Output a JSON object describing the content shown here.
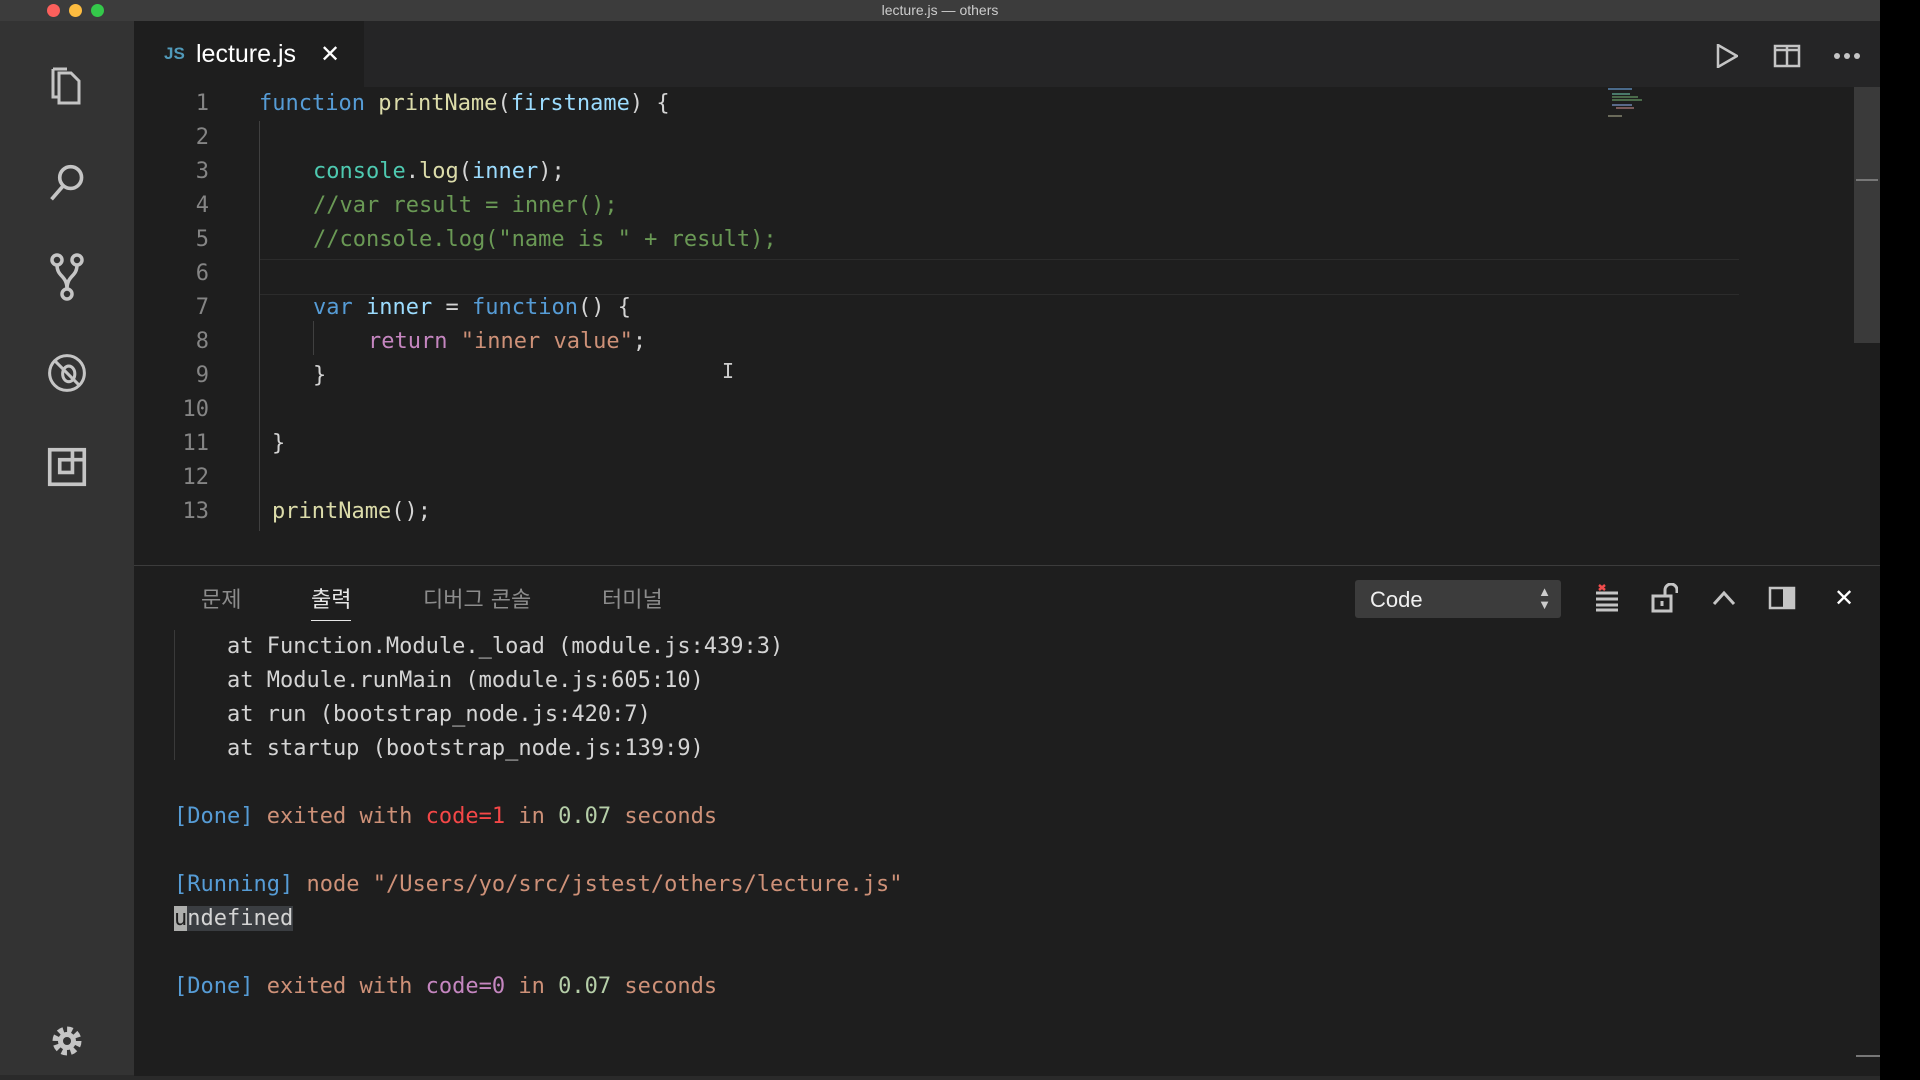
{
  "window": {
    "title": "lecture.js — others"
  },
  "activity_bar": {
    "items": [
      {
        "name": "explorer-icon"
      },
      {
        "name": "search-icon"
      },
      {
        "name": "source-control-icon"
      },
      {
        "name": "debug-icon"
      },
      {
        "name": "extensions-icon"
      }
    ],
    "settings": "gear-icon"
  },
  "tab": {
    "lang": "JS",
    "filename": "lecture.js"
  },
  "editor": {
    "line_numbers": [
      "1",
      "2",
      "3",
      "4",
      "5",
      "6",
      "7",
      "8",
      "9",
      "10",
      "11",
      "12",
      "13"
    ],
    "lines": {
      "l1": {
        "kw": "function",
        "sp": " ",
        "fn": "printName",
        "p1": "(",
        "param": "firstname",
        "p2": ") {"
      },
      "l3": {
        "obj": "console",
        "dot": ".",
        "fn": "log",
        "p1": "(",
        "arg": "inner",
        "p2": ");"
      },
      "l4": {
        "comment": "//var result = inner();"
      },
      "l5": {
        "comment": "//console.log(\"name is \" + result);"
      },
      "l7": {
        "kw": "var",
        "sp": " ",
        "name": "inner",
        "eq": " = ",
        "kw2": "function",
        "rest": "() {"
      },
      "l8": {
        "ret": "return",
        "sp": " ",
        "str": "\"inner value\"",
        "semi": ";"
      },
      "l9": {
        "brace": "}"
      },
      "l11": {
        "brace": "}"
      },
      "l13": {
        "fn": "printName",
        "rest": "();"
      }
    }
  },
  "panel": {
    "tabs": [
      "문제",
      "출력",
      "디버그 콘솔",
      "터미널"
    ],
    "active_tab": "출력",
    "channel": "Code",
    "output": {
      "stack": [
        "    at Function.Module._load (module.js:439:3)",
        "    at Module.runMain (module.js:605:10)",
        "    at run (bootstrap_node.js:420:7)",
        "    at startup (bootstrap_node.js:139:9)"
      ],
      "done1": {
        "tag": "[Done]",
        "a": " exited with ",
        "code": "code=1",
        "b": " in ",
        "time": "0.07",
        "c": " seconds"
      },
      "running": {
        "tag": "[Running]",
        "a": " node ",
        "path": "\"/Users/yo/src/jstest/others/lecture.js\""
      },
      "result": {
        "caret": "u",
        "rest": "ndefined"
      },
      "done2": {
        "tag": "[Done]",
        "a": " exited with ",
        "code": "code=0",
        "b": " in ",
        "time": "0.07",
        "c": " seconds"
      }
    }
  },
  "colors": {
    "activity_bar": "#333333",
    "editor_bg": "#1e1e1e",
    "keyword": "#569cd6",
    "comment": "#6a9955",
    "string": "#ce9178"
  }
}
